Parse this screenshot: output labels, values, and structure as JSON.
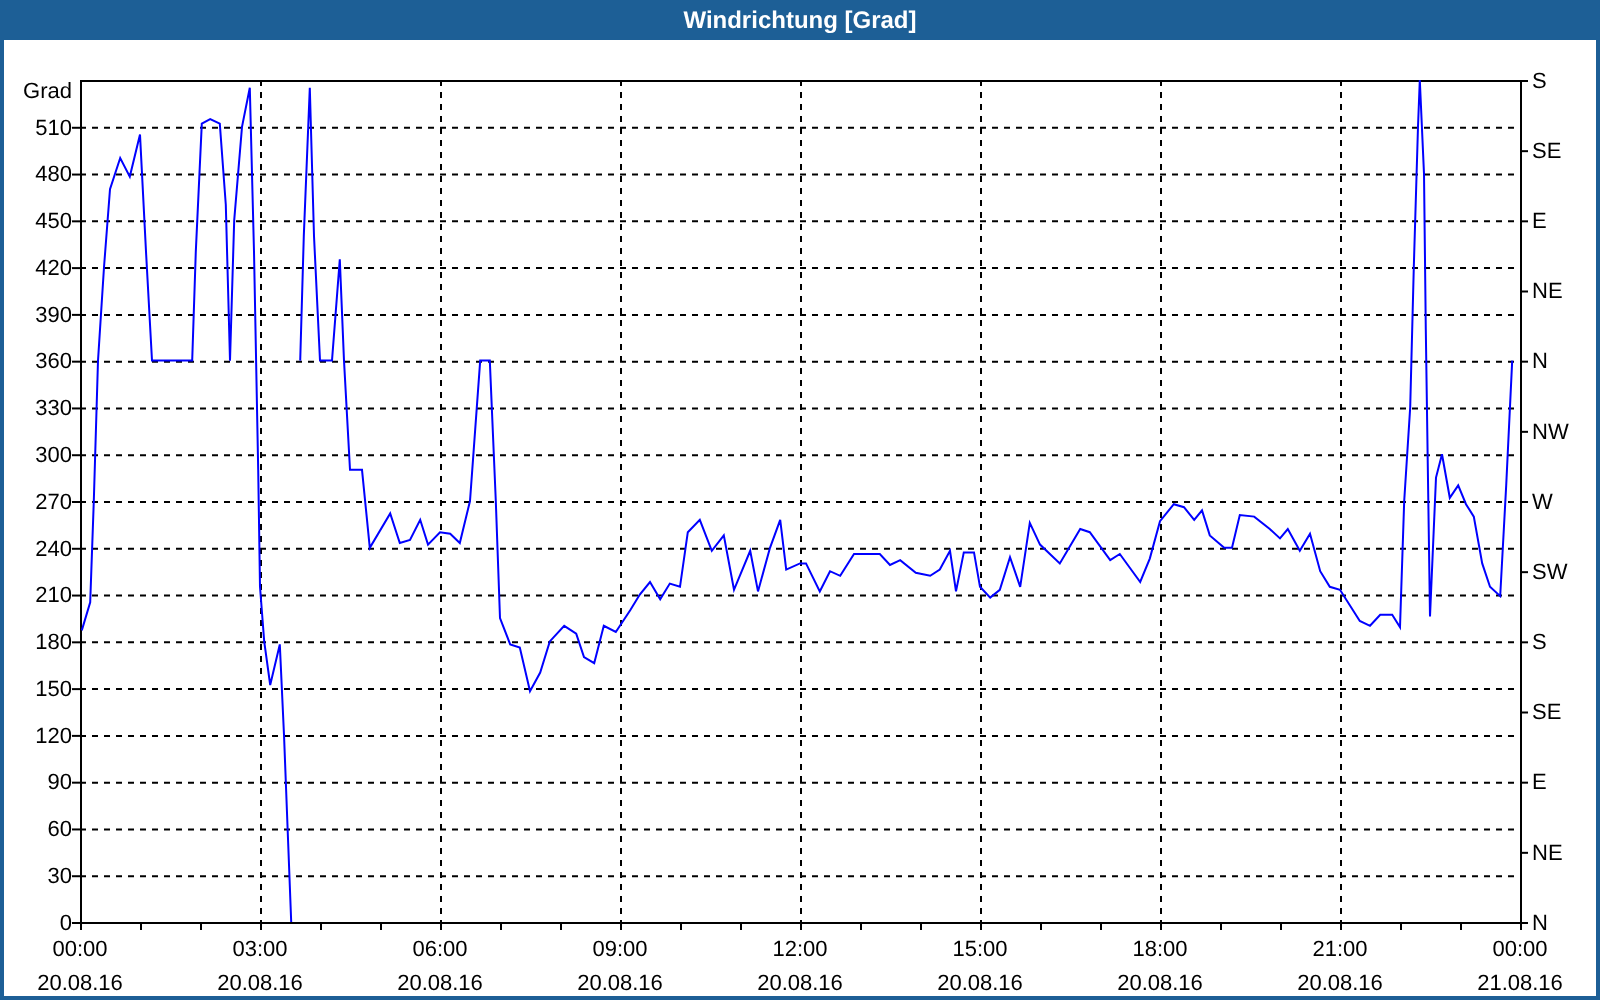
{
  "window": {
    "title": "Windrichtung [Grad]"
  },
  "chart": {
    "chart_data": {
      "type": "line",
      "grid": true,
      "ylabel": "Grad",
      "xlim": [
        0,
        24
      ],
      "ylim": [
        0,
        540
      ],
      "yticks": [
        0,
        30,
        60,
        90,
        120,
        150,
        180,
        210,
        240,
        270,
        300,
        330,
        360,
        390,
        420,
        450,
        480,
        510
      ],
      "xticks": [
        {
          "value": 0,
          "label": "00:00"
        },
        {
          "value": 3,
          "label": "03:00"
        },
        {
          "value": 6,
          "label": "06:00"
        },
        {
          "value": 9,
          "label": "09:00"
        },
        {
          "value": 12,
          "label": "12:00"
        },
        {
          "value": 15,
          "label": "15:00"
        },
        {
          "value": 18,
          "label": "18:00"
        },
        {
          "value": 21,
          "label": "21:00"
        },
        {
          "value": 24,
          "label": "00:00"
        }
      ],
      "x": [
        0.03,
        0.17,
        0.23,
        0.3,
        0.4,
        0.5,
        0.67,
        0.83,
        1.0,
        1.1,
        1.2,
        1.87,
        1.93,
        2.03,
        2.17,
        2.33,
        2.43,
        2.5,
        2.57,
        2.7,
        2.83,
        2.9,
        2.97,
        3.0,
        3.07,
        3.17,
        3.33,
        3.4,
        3.47,
        3.52,
        3.6,
        3.67,
        3.73,
        3.83,
        3.9,
        4.0,
        4.2,
        4.33,
        4.4,
        4.5,
        4.7,
        4.83,
        5.17,
        5.33,
        5.5,
        5.67,
        5.8,
        6.0,
        6.17,
        6.33,
        6.5,
        6.67,
        6.83,
        6.93,
        7.0,
        7.17,
        7.33,
        7.5,
        7.67,
        7.83,
        8.07,
        8.27,
        8.4,
        8.57,
        8.73,
        8.93,
        9.17,
        9.33,
        9.5,
        9.67,
        9.83,
        10.0,
        10.13,
        10.33,
        10.53,
        10.73,
        10.9,
        11.17,
        11.3,
        11.5,
        11.67,
        11.77,
        12.0,
        12.1,
        12.33,
        12.5,
        12.67,
        12.9,
        13.33,
        13.5,
        13.67,
        13.93,
        14.17,
        14.33,
        14.5,
        14.6,
        14.73,
        14.9,
        15.0,
        15.17,
        15.33,
        15.5,
        15.67,
        15.83,
        16.0,
        16.33,
        16.67,
        16.83,
        17.17,
        17.33,
        17.67,
        17.83,
        18.0,
        18.23,
        18.4,
        18.57,
        18.7,
        18.83,
        19.07,
        19.2,
        19.33,
        19.57,
        19.83,
        20.0,
        20.13,
        20.33,
        20.5,
        20.67,
        20.83,
        21.0,
        21.33,
        21.5,
        21.67,
        21.87,
        22.0,
        22.07,
        22.17,
        22.23,
        22.3,
        22.33,
        22.4,
        22.43,
        22.5,
        22.6,
        22.7,
        22.83,
        22.97,
        23.1,
        23.23,
        23.37,
        23.5,
        23.67,
        23.77,
        23.87
      ],
      "series": [
        {
          "color": "#0000ff",
          "values": [
            187,
            205,
            270,
            360,
            420,
            470,
            490,
            478,
            505,
            430,
            360,
            360,
            430,
            512,
            515,
            512,
            460,
            360,
            450,
            510,
            535,
            430,
            290,
            215,
            180,
            152,
            178,
            120,
            50,
            0,
            null,
            360,
            440,
            535,
            440,
            360,
            360,
            425,
            360,
            290,
            290,
            240,
            262,
            243,
            245,
            258,
            242,
            250,
            249,
            243,
            270,
            360,
            360,
            270,
            195,
            178,
            176,
            148,
            160,
            180,
            190,
            185,
            170,
            166,
            190,
            186,
            200,
            210,
            218,
            207,
            217,
            215,
            250,
            258,
            238,
            248,
            213,
            238,
            212,
            240,
            258,
            226,
            230,
            230,
            212,
            225,
            222,
            236,
            236,
            229,
            232,
            224,
            222,
            226,
            238,
            212,
            237,
            237,
            215,
            208,
            213,
            234,
            215,
            256,
            242,
            230,
            252,
            250,
            232,
            236,
            218,
            233,
            257,
            268,
            266,
            258,
            264,
            248,
            240,
            240,
            261,
            260,
            252,
            246,
            252,
            238,
            249,
            225,
            215,
            213,
            193,
            190,
            197,
            197,
            189,
            270,
            330,
            420,
            510,
            540,
            480,
            380,
            196,
            285,
            300,
            272,
            280,
            268,
            260,
            230,
            215,
            209,
            280,
            360
          ]
        }
      ]
    },
    "x_dates": [
      "20.08.16",
      "20.08.16",
      "20.08.16",
      "20.08.16",
      "20.08.16",
      "20.08.16",
      "20.08.16",
      "20.08.16",
      "21.08.16"
    ],
    "compass_labels": [
      "S",
      "SE",
      "E",
      "NE",
      "N",
      "NW",
      "W",
      "SW",
      "S",
      "SE",
      "E",
      "NE",
      "N"
    ]
  }
}
